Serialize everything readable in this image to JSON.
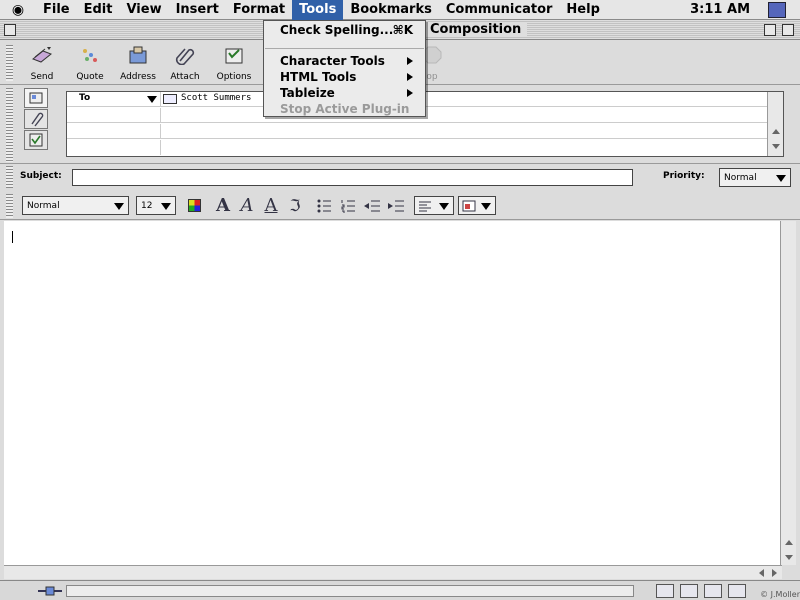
{
  "menubar": {
    "apple_glyph": "",
    "items": [
      "File",
      "Edit",
      "View",
      "Insert",
      "Format",
      "Tools",
      "Bookmarks",
      "Communicator",
      "Help"
    ],
    "active": "Tools",
    "clock": "3:11 AM"
  },
  "window": {
    "title": "Composition"
  },
  "toolbar": {
    "buttons": [
      {
        "label": "Send",
        "icon": "send-icon"
      },
      {
        "label": "Quote",
        "icon": "quote-icon"
      },
      {
        "label": "Address",
        "icon": "address-book-icon"
      },
      {
        "label": "Attach",
        "icon": "paperclip-icon"
      },
      {
        "label": "Options",
        "icon": "options-icon"
      },
      {
        "label": "op",
        "icon": "stop-icon"
      }
    ]
  },
  "address": {
    "to_label": "To",
    "recipient": "Scott Summers"
  },
  "subject": {
    "label": "Subject:",
    "value": ""
  },
  "priority": {
    "label": "Priority:",
    "value": "Normal"
  },
  "format": {
    "paragraph_style": "Normal",
    "font_size": "12"
  },
  "tools_menu": {
    "items": [
      {
        "label": "Check Spelling...",
        "shortcut": "⌘K",
        "enabled": true,
        "submenu": false
      },
      {
        "label": "Character Tools",
        "enabled": true,
        "submenu": true
      },
      {
        "label": "HTML Tools",
        "enabled": true,
        "submenu": true
      },
      {
        "label": "Tableize",
        "enabled": true,
        "submenu": true
      },
      {
        "label": "Stop Active Plug-in",
        "enabled": false,
        "submenu": false
      }
    ]
  },
  "status": {
    "watermark": "© J.Moller"
  }
}
